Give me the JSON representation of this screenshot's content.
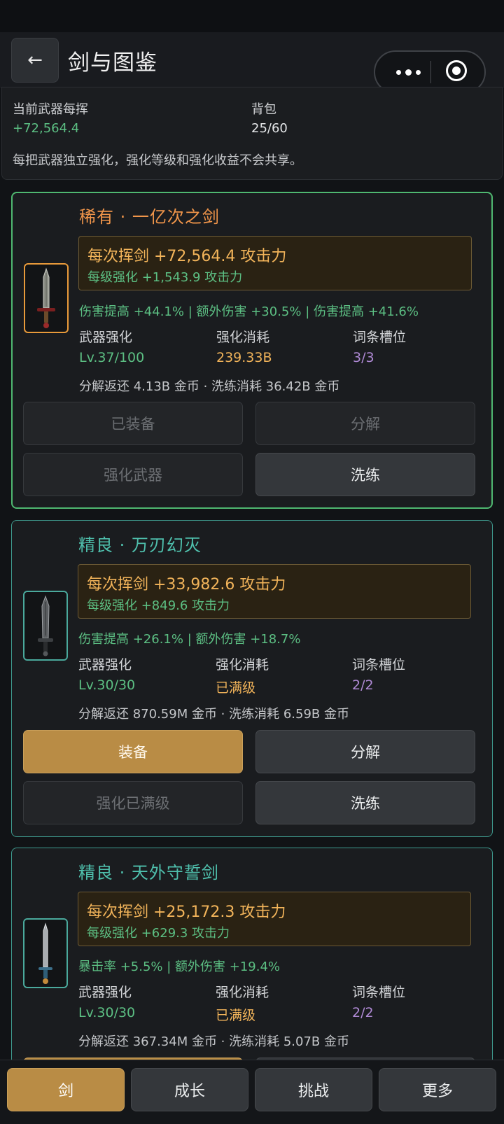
{
  "nav": {
    "title": "剑与图鉴",
    "back_icon": "←"
  },
  "summary": {
    "swing_label": "当前武器每挥",
    "swing_value": "+72,564.4",
    "bag_label": "背包",
    "bag_value": "25/60",
    "note": "每把武器独立强化，强化等级和强化收益不会共享。"
  },
  "labels": {
    "enhance": "武器强化",
    "cost": "强化消耗",
    "slots": "词条槽位"
  },
  "weapons": [
    {
      "title": "稀有 · 一亿次之剑",
      "swing": "每次挥剑  +72,564.4 攻击力",
      "per_level": "每级强化  +1,543.9 攻击力",
      "affixes": "伤害提高 +44.1%  |  额外伤害 +30.5%  |  伤害提高 +41.6%",
      "enhance_level": "Lv.37/100",
      "enhance_cost": "239.33B",
      "slots": "3/3",
      "returns": "分解返还 4.13B 金币 · 洗练消耗 36.42B 金币",
      "btn_equip": "已装备",
      "btn_decompose": "分解",
      "btn_enhance": "强化武器",
      "btn_reroll": "洗练"
    },
    {
      "title": "精良 · 万刃幻灭",
      "swing": "每次挥剑  +33,982.6 攻击力",
      "per_level": "每级强化  +849.6 攻击力",
      "affixes": "伤害提高 +26.1%  |  额外伤害 +18.7%",
      "enhance_level": "Lv.30/30",
      "enhance_cost": "已满级",
      "slots": "2/2",
      "returns": "分解返还 870.59M 金币 · 洗练消耗 6.59B 金币",
      "btn_equip": "装备",
      "btn_decompose": "分解",
      "btn_enhance": "强化已满级",
      "btn_reroll": "洗练"
    },
    {
      "title": "精良 · 天外守誓剑",
      "swing": "每次挥剑  +25,172.3 攻击力",
      "per_level": "每级强化  +629.3 攻击力",
      "affixes": "暴击率 +5.5%  |  额外伤害 +19.4%",
      "enhance_level": "Lv.30/30",
      "enhance_cost": "已满级",
      "slots": "2/2",
      "returns": "分解返还 367.34M 金币 · 洗练消耗 5.07B 金币"
    }
  ],
  "tabs": [
    "剑",
    "成长",
    "挑战",
    "更多"
  ],
  "colors": {
    "accent_gold": "#b98c45",
    "rare_border": "#4fb870",
    "fine_border": "#3e9a8e",
    "stat_green": "#5cbf83",
    "stat_gold": "#f2b45a",
    "stat_purple": "#b08ad6"
  }
}
